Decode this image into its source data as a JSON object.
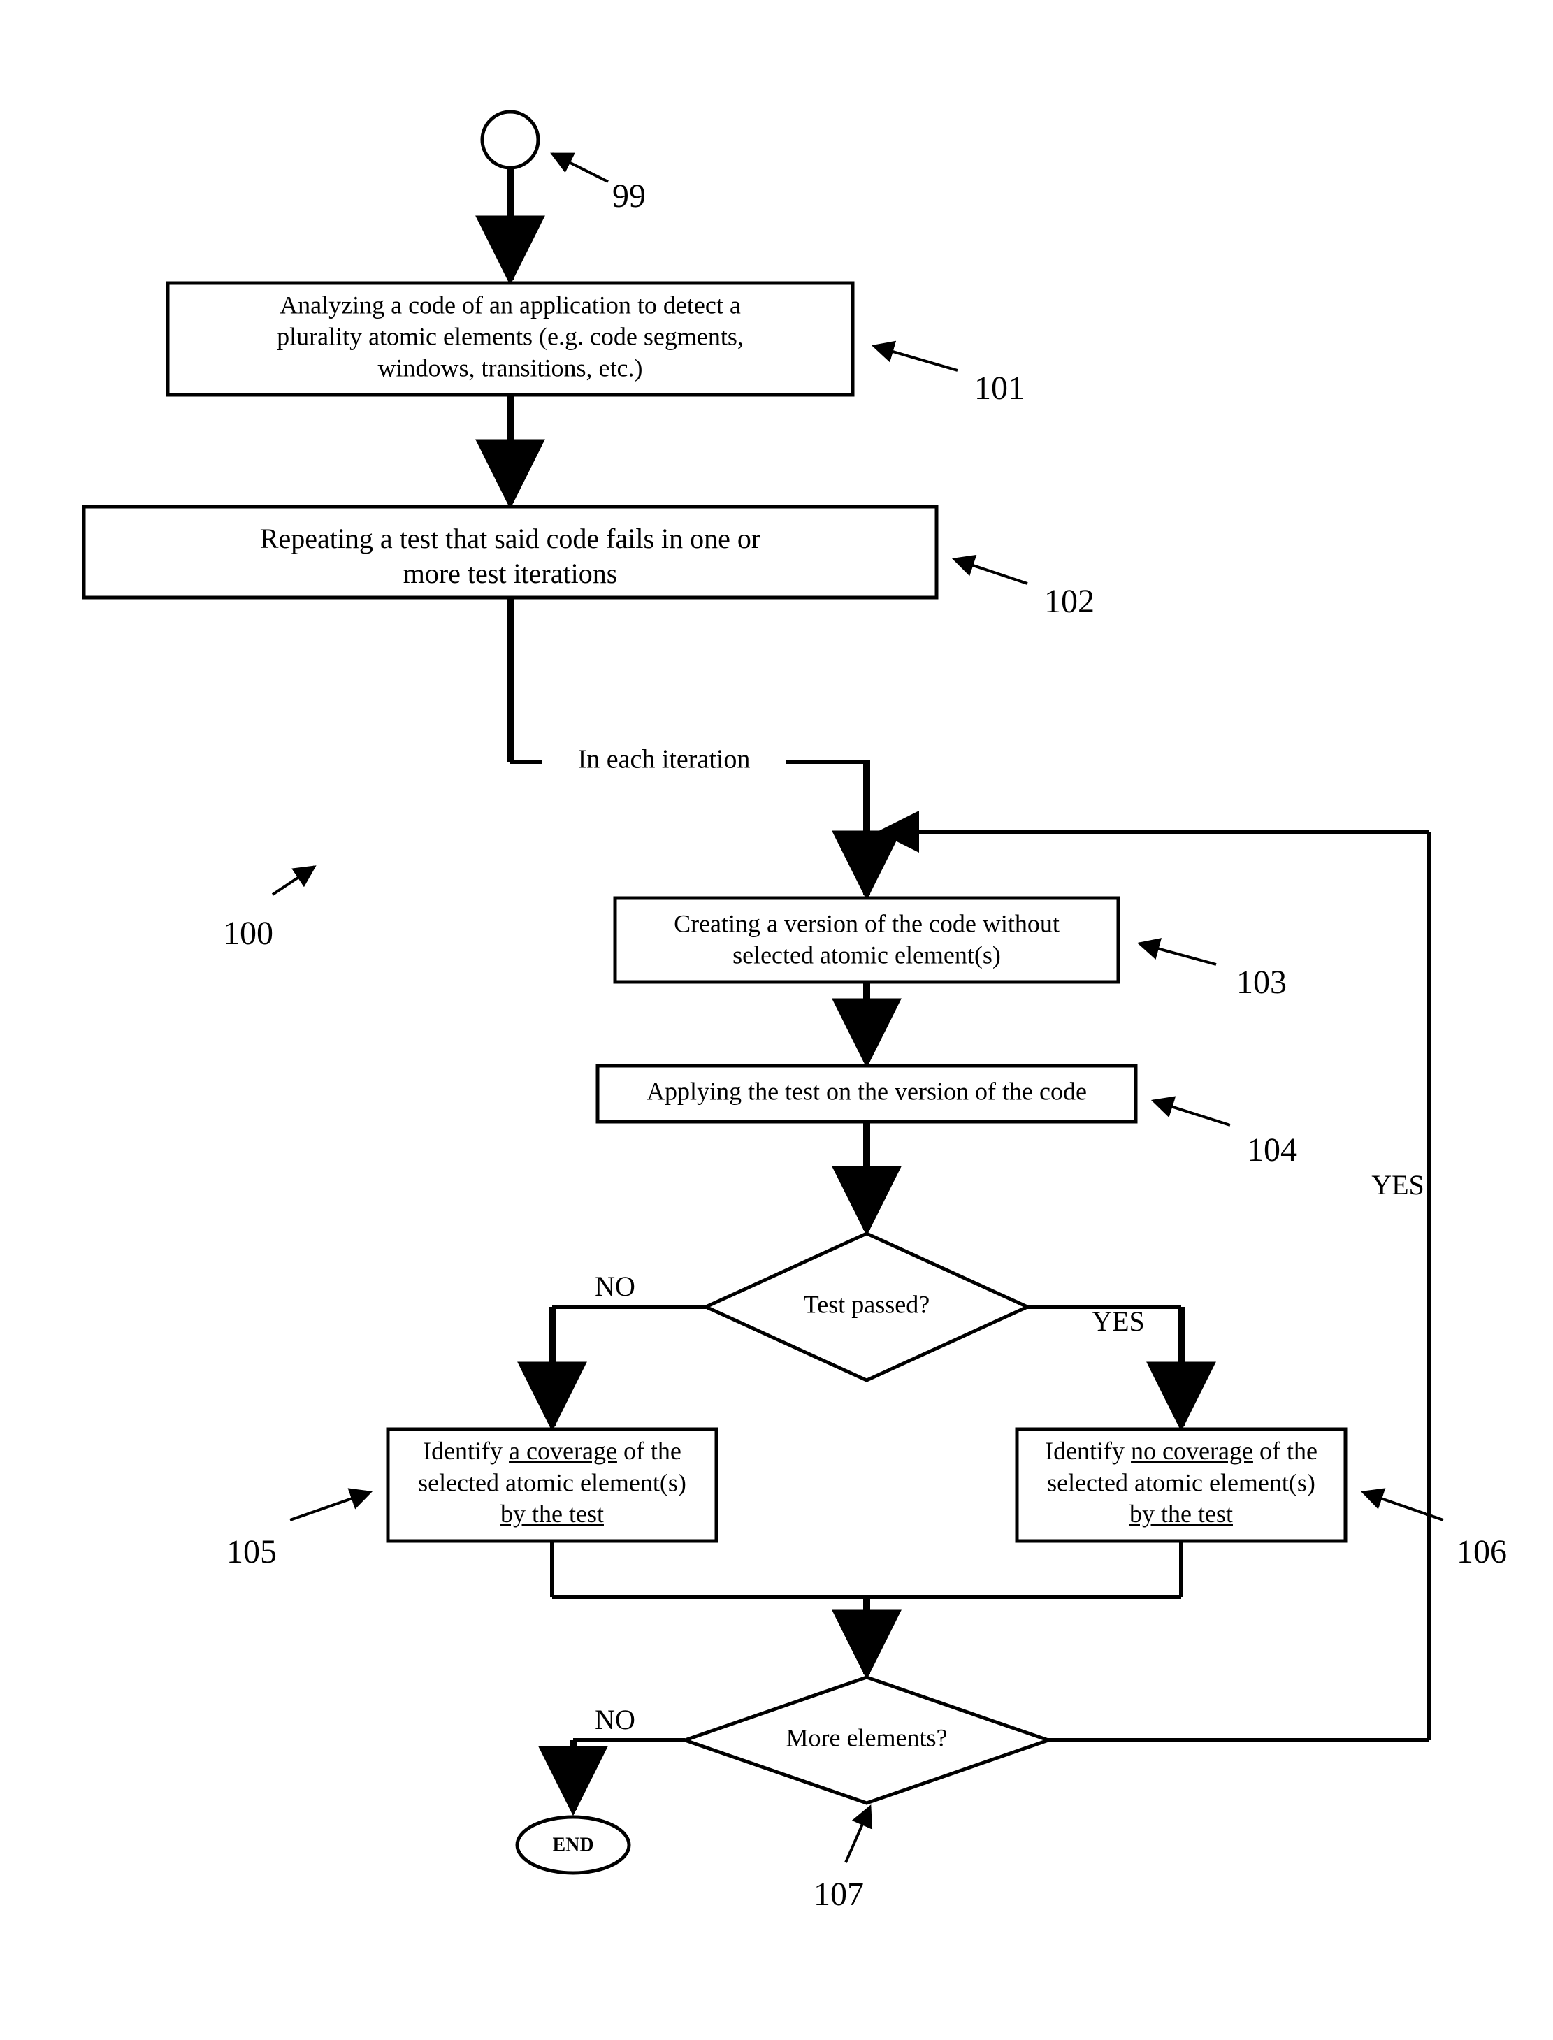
{
  "refs": {
    "start": "99",
    "analyze": "101",
    "repeat": "102",
    "create": "103",
    "apply": "104",
    "cov_yes": "105",
    "cov_no": "106",
    "more": "107",
    "diagram": "100"
  },
  "nodes": {
    "analyze": {
      "l1": "Analyzing a code of an application to detect a",
      "l2": "plurality atomic elements (e.g. code segments,",
      "l3": "windows, transitions, etc.)"
    },
    "repeat": {
      "l1": "Repeating a test that said code fails in one or",
      "l2": "more test iterations"
    },
    "iter_label": "In each iteration",
    "create": {
      "l1": "Creating a version of the code without",
      "l2": "selected atomic element(s)"
    },
    "apply": {
      "l1": "Applying the test on the version of the code"
    },
    "dec1": "Test passed?",
    "dec1_no": "NO",
    "dec1_yes": "YES",
    "cov_yes": {
      "l1_a": "Identify ",
      "l1_b": "a coverage",
      "l1_c": " of the",
      "l2": "selected atomic element(s)",
      "l3_a": "by the test"
    },
    "cov_no": {
      "l1_a": "Identify ",
      "l1_b": "no coverage",
      "l1_c": " of the",
      "l2": "selected atomic element(s)",
      "l3_a": "by the test"
    },
    "dec2": "More elements?",
    "dec2_no": "NO",
    "dec2_yes": "YES",
    "end": "END"
  }
}
